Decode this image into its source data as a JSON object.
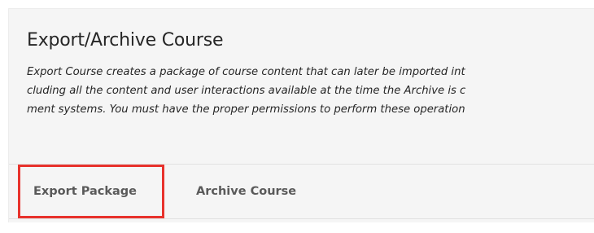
{
  "header": {
    "title": "Export/Archive Course",
    "description_lines": [
      "Export Course creates a package of course content that can later be imported int",
      "cluding all the content and user interactions available at the time the Archive is c",
      "ment systems. You must have the proper permissions to perform these operation"
    ]
  },
  "tabs": [
    {
      "label": "Export Package"
    },
    {
      "label": "Archive Course"
    }
  ],
  "colors": {
    "highlight": "#e8322c",
    "panel_background": "#f5f5f5",
    "tab_text": "#5a5a5a"
  }
}
